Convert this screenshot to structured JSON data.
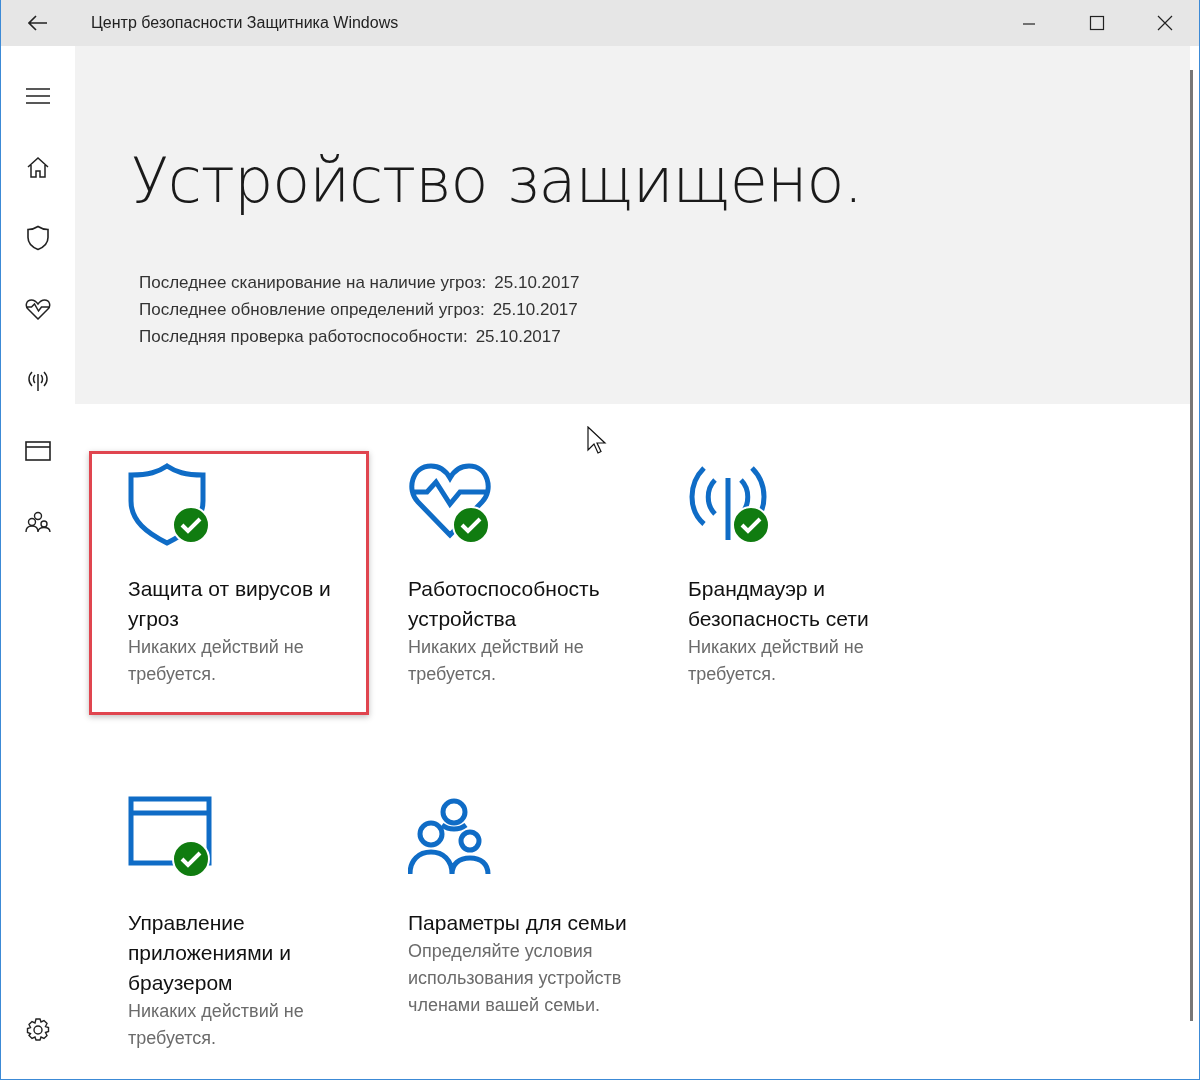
{
  "window": {
    "title": "Центр безопасности Защитника Windows"
  },
  "status": {
    "heading": "Устройство защищено.",
    "details": [
      {
        "label": "Последнее сканирование на наличие угроз:",
        "value": "25.10.2017"
      },
      {
        "label": "Последнее обновление определений угроз:",
        "value": "25.10.2017"
      },
      {
        "label": "Последняя проверка работоспособности:",
        "value": "25.10.2017"
      }
    ]
  },
  "tiles": [
    {
      "kind": "shield",
      "title": "Защита от вирусов и угроз",
      "description": "Никаких действий не требуется.",
      "ok": true,
      "highlighted": true
    },
    {
      "kind": "heart",
      "title": "Работоспособность устройства",
      "description": "Никаких действий не требуется.",
      "ok": true,
      "highlighted": false
    },
    {
      "kind": "antenna",
      "title": "Брандмауэр и безопасность сети",
      "description": "Никаких действий не требуется.",
      "ok": true,
      "highlighted": false
    },
    {
      "kind": "window",
      "title": "Управление приложениями и браузером",
      "description": "Никаких действий не требуется.",
      "ok": true,
      "highlighted": false
    },
    {
      "kind": "family",
      "title": "Параметры для семьи",
      "description": "Определяйте условия использования устройств членами вашей семьи.",
      "ok": false,
      "highlighted": false
    }
  ]
}
